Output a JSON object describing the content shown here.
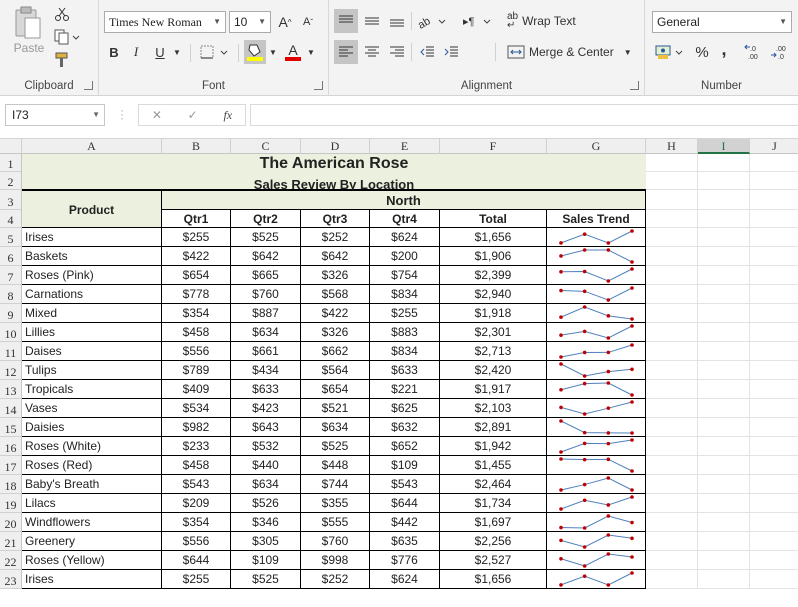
{
  "ribbon": {
    "clipboard": {
      "group": "Clipboard",
      "paste": "Paste"
    },
    "font": {
      "group": "Font",
      "family": "Times New Roman",
      "size": "10",
      "bold": "B",
      "italic": "I",
      "underline": "U",
      "grow": "A",
      "shrink": "A",
      "color_glyph": "A",
      "highlight_color": "#ffff00",
      "font_color": "#e00000"
    },
    "alignment": {
      "group": "Alignment",
      "wrap": "Wrap Text",
      "merge": "Merge & Center"
    },
    "number": {
      "group": "Number",
      "format": "General",
      "percent": "%",
      "comma": ","
    }
  },
  "formula_bar": {
    "name_box": "I73",
    "cancel": "✕",
    "enter": "✓",
    "fx": "fx",
    "formula": ""
  },
  "columns": [
    "A",
    "B",
    "C",
    "D",
    "E",
    "F",
    "G",
    "H",
    "I",
    "J"
  ],
  "rows": [
    "1",
    "2",
    "3",
    "4",
    "5",
    "6",
    "7",
    "8",
    "9",
    "10",
    "11",
    "12",
    "13",
    "14",
    "15",
    "16",
    "17",
    "18",
    "19",
    "20",
    "21",
    "22",
    "23"
  ],
  "sheet": {
    "title": "The American Rose",
    "subtitle": "Sales Review By Location",
    "product_header": "Product",
    "region_header": "North",
    "col_headers": [
      "Qtr1",
      "Qtr2",
      "Qtr3",
      "Qtr4",
      "Total",
      "Sales Trend"
    ],
    "header_fill": "#ebf1de",
    "sparkline_color": "#4f81bd",
    "marker_color": "#c00000",
    "data": [
      [
        "Irises",
        "$255",
        "$525",
        "$252",
        "$624",
        "$1,656"
      ],
      [
        "Baskets",
        "$422",
        "$642",
        "$642",
        "$200",
        "$1,906"
      ],
      [
        "Roses (Pink)",
        "$654",
        "$665",
        "$326",
        "$754",
        "$2,399"
      ],
      [
        "Carnations",
        "$778",
        "$760",
        "$568",
        "$834",
        "$2,940"
      ],
      [
        "Mixed",
        "$354",
        "$887",
        "$422",
        "$255",
        "$1,918"
      ],
      [
        "Lillies",
        "$458",
        "$634",
        "$326",
        "$883",
        "$2,301"
      ],
      [
        "Daises",
        "$556",
        "$661",
        "$662",
        "$834",
        "$2,713"
      ],
      [
        "Tulips",
        "$789",
        "$434",
        "$564",
        "$633",
        "$2,420"
      ],
      [
        "Tropicals",
        "$409",
        "$633",
        "$654",
        "$221",
        "$1,917"
      ],
      [
        "Vases",
        "$534",
        "$423",
        "$521",
        "$625",
        "$2,103"
      ],
      [
        "Daisies",
        "$982",
        "$643",
        "$634",
        "$632",
        "$2,891"
      ],
      [
        "Roses (White)",
        "$233",
        "$532",
        "$525",
        "$652",
        "$1,942"
      ],
      [
        "Roses (Red)",
        "$458",
        "$440",
        "$448",
        "$109",
        "$1,455"
      ],
      [
        "Baby's Breath",
        "$543",
        "$634",
        "$744",
        "$543",
        "$2,464"
      ],
      [
        "Lilacs",
        "$209",
        "$526",
        "$355",
        "$644",
        "$1,734"
      ],
      [
        "Windflowers",
        "$354",
        "$346",
        "$555",
        "$442",
        "$1,697"
      ],
      [
        "Greenery",
        "$556",
        "$305",
        "$760",
        "$635",
        "$2,256"
      ],
      [
        "Roses (Yellow)",
        "$644",
        "$109",
        "$998",
        "$776",
        "$2,527"
      ],
      [
        "Irises",
        "$255",
        "$525",
        "$252",
        "$624",
        "$1,656"
      ]
    ]
  }
}
